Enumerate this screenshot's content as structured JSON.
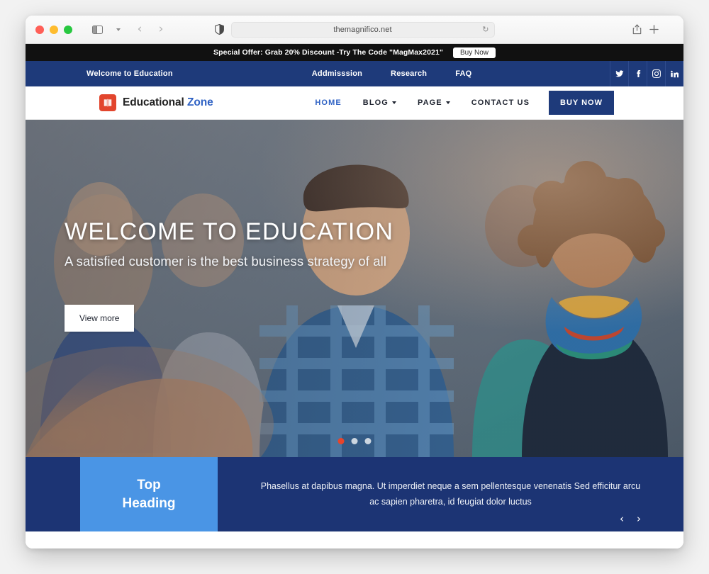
{
  "browser": {
    "url": "themagnifico.net",
    "reload_icon": "reload-icon",
    "shield_icon": "privacy-shield-icon",
    "sidebar_icon": "sidebar-toggle-icon",
    "back_icon": "‹",
    "forward_icon": "›",
    "share_icon": "share-icon",
    "newtab_icon": "+",
    "tabs_icon": "tab-overview-icon"
  },
  "offer_bar": {
    "text": "Special Offer: Grab 20% Discount -Try The Code \"MagMax2021\"",
    "button": "Buy Now"
  },
  "top_nav": {
    "welcome": "Welcome to Education",
    "links": [
      "Addmisssion",
      "Research",
      "FAQ"
    ],
    "socials": [
      "twitter-icon",
      "facebook-icon",
      "instagram-icon",
      "linkedin-icon"
    ]
  },
  "header": {
    "logo_primary": "Educational",
    "logo_accent": "Zone",
    "logo_icon": "book-icon",
    "menu": [
      {
        "label": "HOME",
        "active": true,
        "caret": false
      },
      {
        "label": "BLOG",
        "active": false,
        "caret": true
      },
      {
        "label": "PAGE",
        "active": false,
        "caret": true
      },
      {
        "label": "CONTACT US",
        "active": false,
        "caret": false
      }
    ],
    "cta": "BUY NOW"
  },
  "hero": {
    "title": "WELCOME TO EDUCATION",
    "subtitle": "A satisfied customer is the best business strategy of all",
    "button": "View more",
    "slides": 3,
    "active_slide": 1
  },
  "bottom": {
    "card_line1": "Top",
    "card_line2": "Heading",
    "paragraph": "Phasellus at dapibus magna. Ut imperdiet neque a sem pellentesque venenatis Sed efficitur arcu ac sapien pharetra, id feugiat dolor luctus",
    "prev": "‹",
    "next": "›"
  },
  "colors": {
    "navy": "#1e3a7a",
    "navy_dark": "#1c3474",
    "light_blue": "#4a95e5",
    "accent_blue": "#2f62c4",
    "logo_red": "#e2452d",
    "offer_black": "#111111",
    "dot_active": "#e8442a"
  }
}
